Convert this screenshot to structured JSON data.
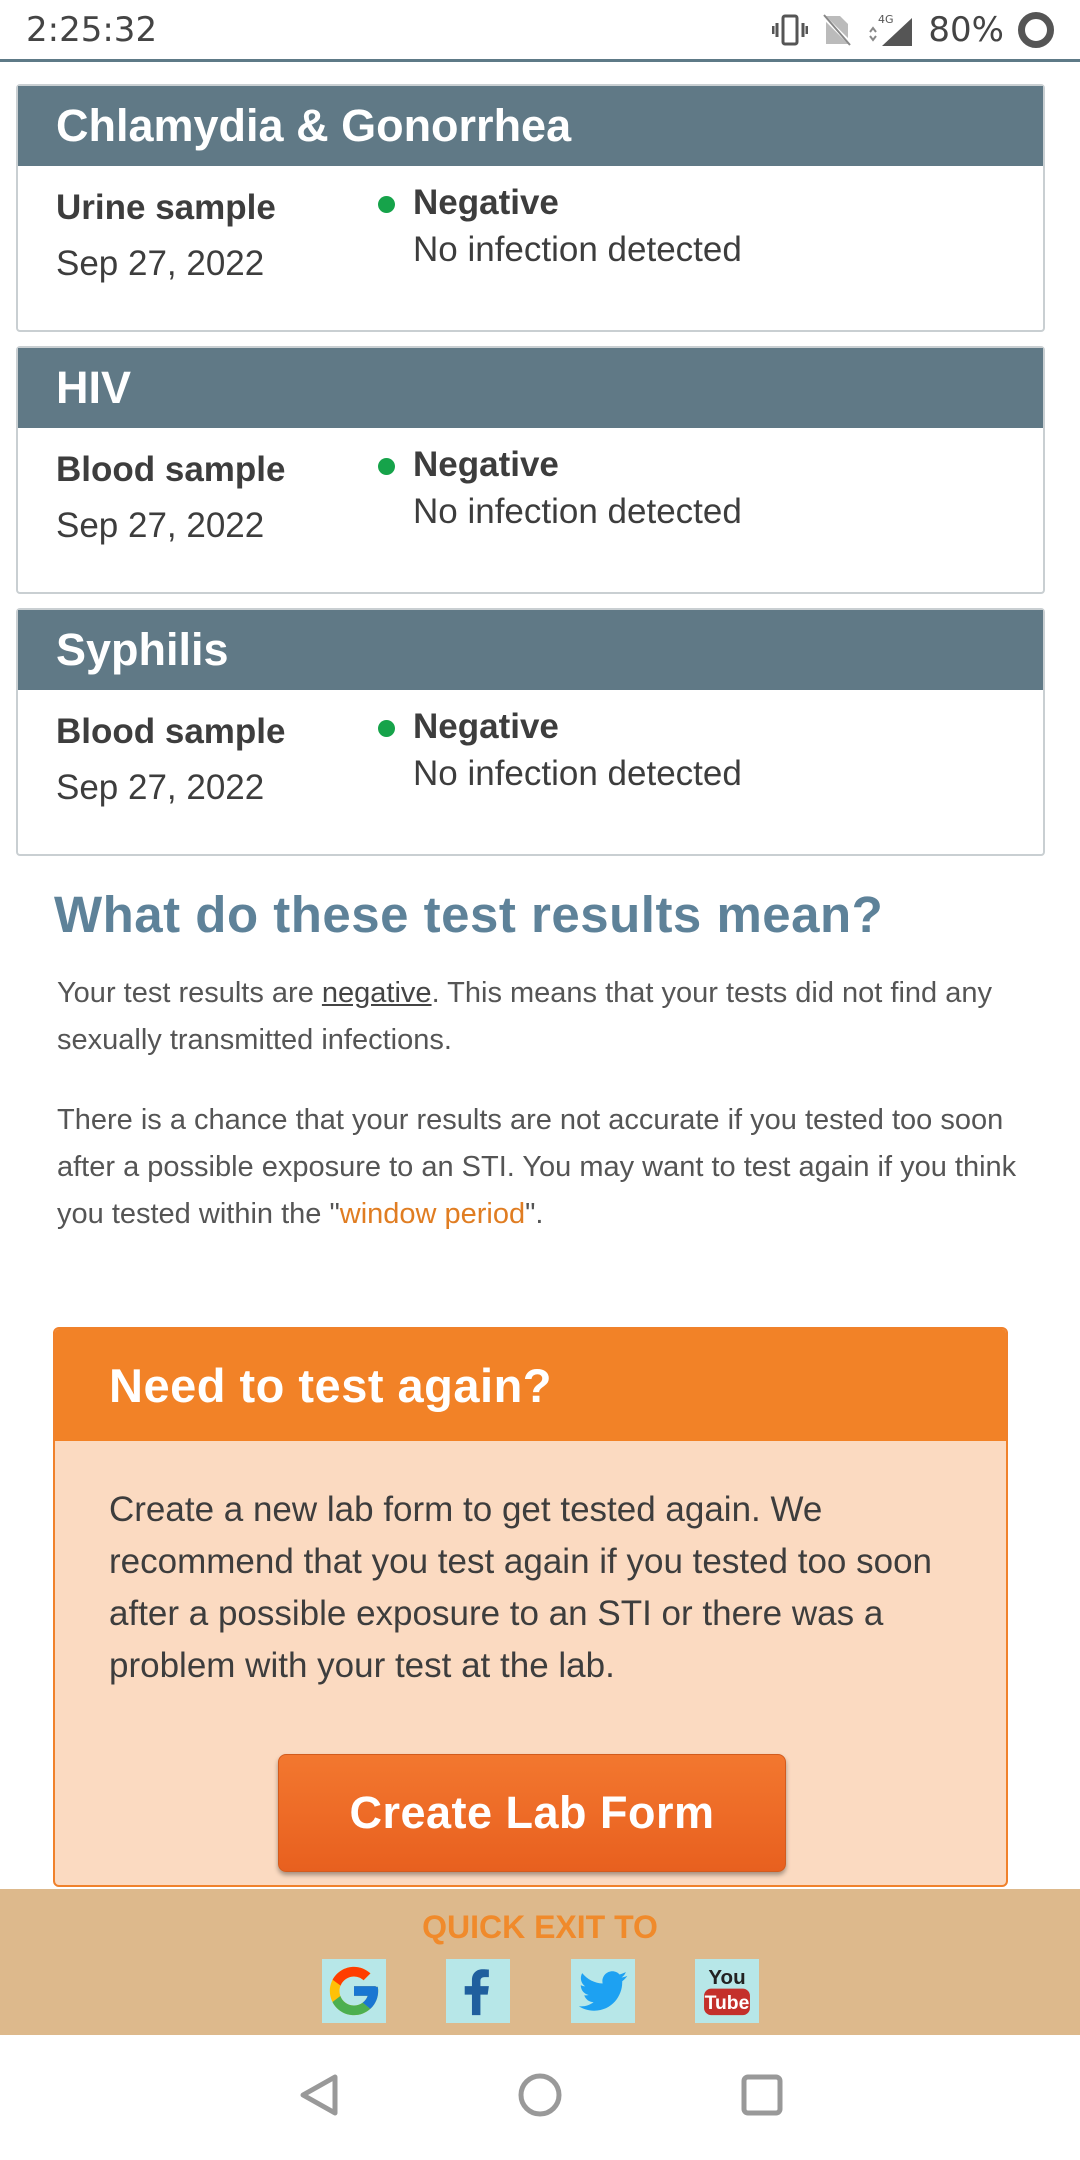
{
  "status_bar": {
    "time": "2:25:32",
    "battery": "80%",
    "network": "4G"
  },
  "results": [
    {
      "test": "Chlamydia & Gonorrhea",
      "sample": "Urine sample",
      "date": "Sep 27, 2022",
      "status": "Negative",
      "detail": "No infection detected",
      "status_color": "#16a34a"
    },
    {
      "test": "HIV",
      "sample": "Blood sample",
      "date": "Sep 27, 2022",
      "status": "Negative",
      "detail": "No infection detected",
      "status_color": "#16a34a"
    },
    {
      "test": "Syphilis",
      "sample": "Blood sample",
      "date": "Sep 27, 2022",
      "status": "Negative",
      "detail": "No infection detected",
      "status_color": "#16a34a"
    }
  ],
  "explanation": {
    "title": "What do these test results mean?",
    "para1_pre": "Your test results are ",
    "para1_link": "negative",
    "para1_post": ". This means that your tests did not find any sexually transmitted infections.",
    "para2_pre": "There is a chance that your results are not accurate if you tested too soon after a possible exposure to an STI. You may want to test again if you think you tested within the \"",
    "para2_link": "window period",
    "para2_post": "\"."
  },
  "test_again": {
    "title": "Need to test again?",
    "text": "Create a new lab form to get tested again. We recommend that you test again if you tested too soon after a possible exposure to an STI or there was a problem with your test at the lab.",
    "button": "Create Lab Form"
  },
  "quick_exit": {
    "label": "QUICK EXIT TO",
    "icons": [
      "google-icon",
      "facebook-icon",
      "twitter-icon",
      "youtube-icon"
    ]
  },
  "nav": {
    "icons": [
      "back-icon",
      "home-icon",
      "recents-icon"
    ]
  },
  "colors": {
    "header": "#607986",
    "accent_orange": "#f28227",
    "title_blue": "#5e8299",
    "quick_exit_bg": "#ddb98c"
  }
}
